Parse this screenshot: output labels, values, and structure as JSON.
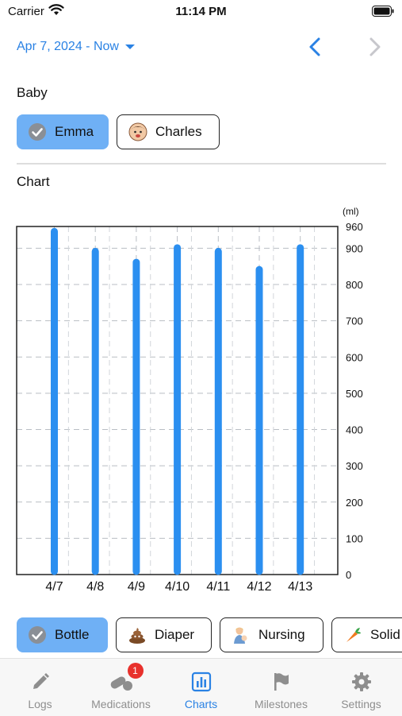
{
  "status": {
    "carrier": "Carrier",
    "time": "11:14 PM"
  },
  "header": {
    "range_label": "Apr 7, 2024 - Now"
  },
  "baby_section": {
    "label": "Baby",
    "babies": [
      {
        "name": "Emma",
        "selected": true
      },
      {
        "name": "Charles",
        "selected": false
      }
    ]
  },
  "chart_section": {
    "label": "Chart"
  },
  "chart_data": {
    "type": "bar",
    "categories": [
      "4/7",
      "4/8",
      "4/9",
      "4/10",
      "4/11",
      "4/12",
      "4/13"
    ],
    "values": [
      955,
      900,
      870,
      910,
      900,
      850,
      910
    ],
    "unit_label": "(ml)",
    "y_ticks": [
      0,
      100,
      200,
      300,
      400,
      500,
      600,
      700,
      800,
      900,
      960
    ],
    "ylim": [
      0,
      960
    ],
    "bar_color": "#2b8ff0",
    "grid": true
  },
  "filters": [
    {
      "label": "Bottle",
      "icon": "bottle-icon",
      "selected": true
    },
    {
      "label": "Diaper",
      "icon": "poop-icon",
      "selected": false
    },
    {
      "label": "Nursing",
      "icon": "nursing-icon",
      "selected": false
    },
    {
      "label": "Solid",
      "icon": "carrot-icon",
      "selected": false
    }
  ],
  "tabs": [
    {
      "label": "Logs",
      "icon": "pencil-icon"
    },
    {
      "label": "Medications",
      "icon": "pills-icon",
      "badge": "1"
    },
    {
      "label": "Charts",
      "icon": "chart-icon",
      "active": true
    },
    {
      "label": "Milestones",
      "icon": "flag-icon"
    },
    {
      "label": "Settings",
      "icon": "gear-icon"
    }
  ],
  "colors": {
    "accent": "#2a82e4",
    "selected_chip": "#6fb0f5",
    "badge": "#e8312c"
  }
}
